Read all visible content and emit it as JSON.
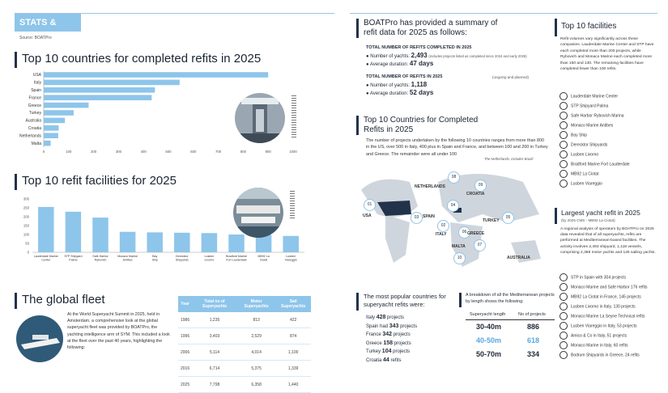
{
  "header": {
    "badge": "STATS & FACTS",
    "source": "Source: BOATPro"
  },
  "countries_section": {
    "title": "Top 10 countries for completed refits in 2025"
  },
  "facilities_section": {
    "title": "Top 10 refit facilities for 2025"
  },
  "fleet_section": {
    "title": "The global fleet",
    "body": "At the World Superyacht Summit in 2025, held in Amsterdam, a comprehensive look at the global superyacht fleet was provided by BOATPro, the yachting intelligence arm of SYM. This included a look at the fleet over the past 40 years, highlighting the following:",
    "table": {
      "headers": [
        "Year",
        "Total no of Superyachts",
        "Motor Superyachts",
        "Sail Superyachts"
      ],
      "rows": [
        [
          "1986",
          "1,235",
          "813",
          "422"
        ],
        [
          "1996",
          "3,403",
          "2,529",
          "874"
        ],
        [
          "2006",
          "5,114",
          "4,014",
          "1,100"
        ],
        [
          "2016",
          "6,714",
          "5,375",
          "1,339"
        ],
        [
          "2025",
          "7,798",
          "6,358",
          "1,440"
        ]
      ]
    }
  },
  "summary": {
    "title": "BOATPro has provided a summary of refit data for 2025 as follows:",
    "completed_heading": "TOTAL NUMBER OF REFITS COMPLETED IN 2025",
    "completed_yachts_label": "Number of yachts:",
    "completed_yachts_value": "2,493",
    "completed_note": "(includes projects listed as completed since 2024 and early 2025)",
    "completed_duration_label": "Average duration:",
    "completed_duration_value": "47 days",
    "ongoing_heading": "TOTAL NUMBER OF REFITS IN 2025",
    "ongoing_note": "(ongoing and planned)",
    "ongoing_yachts_label": "Number of yachts:",
    "ongoing_yachts_value": "1,118",
    "ongoing_duration_label": "Average duration:",
    "ongoing_duration_value": "52 days"
  },
  "map_section": {
    "title": "Top 10 Countries for Completed Refits in 2025",
    "body": "The number of projects undertaken by the following 10 countries ranges from more than 800 in the US, over 500 in Italy, 400 plus in Spain and France, and between 100 and 200 in Turkey and Greece. The remainder were all under 100",
    "credit": "The Netherlands, includes Brazil",
    "labels": [
      {
        "num": "01",
        "name": "USA"
      },
      {
        "num": "02",
        "name": "ITALY"
      },
      {
        "num": "03",
        "name": "SPAIN"
      },
      {
        "num": "04",
        "name": ""
      },
      {
        "num": "05",
        "name": "TURKEY"
      },
      {
        "num": "06",
        "name": "GREECE"
      },
      {
        "num": "07",
        "name": "MALTA"
      },
      {
        "num": "08",
        "name": "NETHERLANDS"
      },
      {
        "num": "09",
        "name": "CROATIA"
      },
      {
        "num": "10",
        "name": "AUSTRALIA"
      }
    ]
  },
  "popular": {
    "title": "The most popular countries for superyacht refits were:",
    "items": [
      {
        "country": "Italy",
        "value": "428",
        "suffix": "projects"
      },
      {
        "country": "Spain had",
        "value": "343",
        "suffix": "projects"
      },
      {
        "country": "France",
        "value": "342",
        "suffix": "projects"
      },
      {
        "country": "Greece",
        "value": "158",
        "suffix": "projects"
      },
      {
        "country": "Turkey",
        "value": "104",
        "suffix": "projects"
      },
      {
        "country": "Croatia",
        "value": "44",
        "suffix": "refits"
      }
    ]
  },
  "length_breakdown": {
    "title": "A breakdown of all the Mediterranean projects by length shows the following:",
    "col1": "Superyacht length",
    "col2": "No of projects",
    "rows": [
      {
        "length": "30-40m",
        "projects": "886"
      },
      {
        "length": "40-50m",
        "projects": "618"
      },
      {
        "length": "50-70m",
        "projects": "334"
      }
    ]
  },
  "top_facilities": {
    "title": "Top 10 facilities",
    "body": "Refit volumes vary significantly across these companies. Lauderdale Marine Center and STP have each completed more than 200 projects, while Rybovich and Monaco Marine each completed more than 150 and 130. The remaining facilities have completed fewer than 100 refits.",
    "items": [
      "Lauderdale Marine Center",
      "STP Shipyard Palma",
      "Safe Harbor Rybovich Marina",
      "Monaco Marine Antibes",
      "Bay Ship",
      "Derecktor Shipyards",
      "Lusben Livorno",
      "Bradford Marine Fort Lauderdale",
      "MB92 La Ciotat",
      "Lusben Viareggio"
    ]
  },
  "largest": {
    "title": "Largest yacht refit in 2025",
    "subtitle": "(by 2025 CMS - MB92 La Ciotat)",
    "body": "A regional analysis of operators by BOATPro on 2025 data revealed that of all superyachts, refits are performed at Mediterranean-based facilities. The activity involves 2,493 shipyard, 1,118 vessels, comprising 2,368 motor yachts and 125 sailing yachts.",
    "items": [
      "STP in Spain with 304 projects",
      "Monaco Marine and Safe Harbor 176 refits",
      "MB92 La Ciotat in France, 145 projects",
      "Lusben Livorno in Italy, 130 projects",
      "Monaco Marine La Seyne Technical refits",
      "Lusben Viareggio in Italy, 53 projects",
      "Amico & Co in Italy, 51 projects",
      "Monaco Marine in Italy, 60 refits",
      "Bodrum Shipyards in Greece, 24 refits"
    ]
  },
  "chart_data": [
    {
      "type": "bar",
      "orientation": "horizontal",
      "categories": [
        "USA",
        "Italy",
        "Spain",
        "France",
        "Greece",
        "Turkey",
        "Australia",
        "Croatia",
        "Netherlands",
        "Malta"
      ],
      "values": [
        900,
        545,
        446,
        433,
        180,
        120,
        85,
        60,
        58,
        28
      ],
      "xlim": [
        0,
        1000
      ],
      "xticks": [
        "0",
        "100",
        "200",
        "300",
        "400",
        "500",
        "600",
        "700",
        "800",
        "900",
        "1000"
      ],
      "grid": false
    },
    {
      "type": "bar",
      "orientation": "vertical",
      "categories": [
        "Lauderdale Marine Center",
        "STP Shipyard Palma",
        "Safe Harbor Rybovich",
        "Monaco Marine Antibes",
        "Bay Ship",
        "Derecktor Shipyards",
        "Lusben Livorno",
        "Bradford Marine Fort Lauderdale",
        "MB92 La Ciotat",
        "Lusben Viareggio"
      ],
      "values": [
        255,
        228,
        195,
        115,
        112,
        110,
        108,
        100,
        98,
        92
      ],
      "ylim": [
        0,
        300
      ],
      "yticks": [
        "0",
        "50",
        "100",
        "150",
        "200",
        "250",
        "300"
      ],
      "grid": false
    }
  ]
}
